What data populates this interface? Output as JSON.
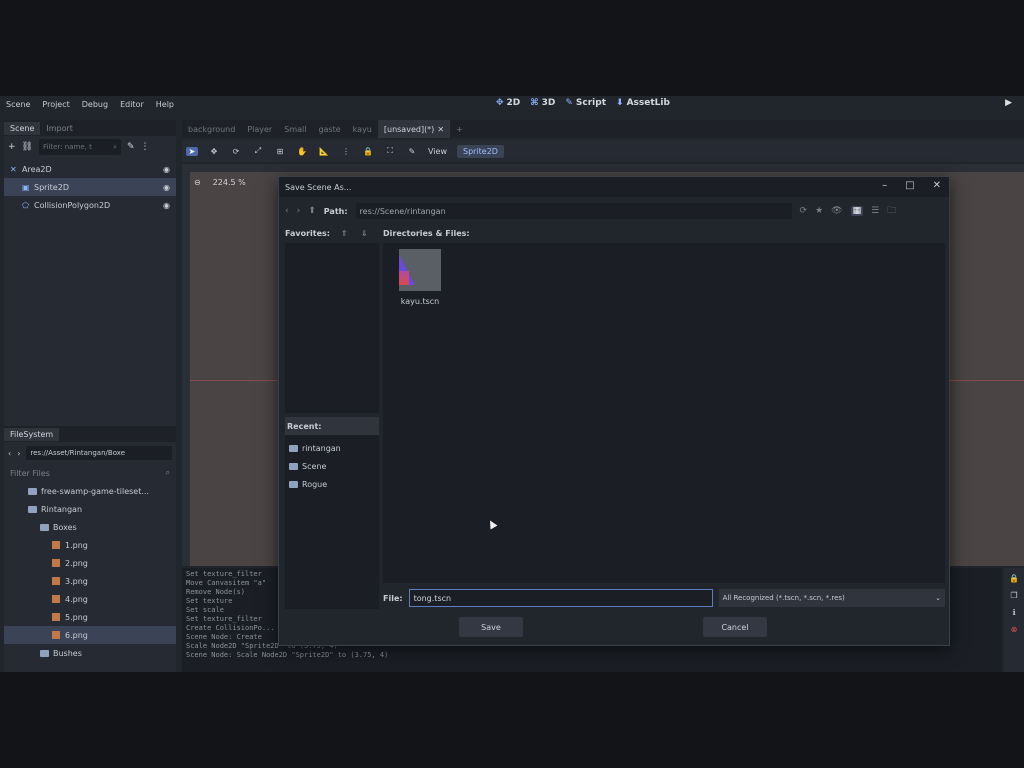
{
  "menu": [
    "Scene",
    "Project",
    "Debug",
    "Editor",
    "Help"
  ],
  "workspaces": [
    {
      "label": "2D",
      "icon": "2d-icon"
    },
    {
      "label": "3D",
      "icon": "3d-icon"
    },
    {
      "label": "Script",
      "icon": "script-icon"
    },
    {
      "label": "AssetLib",
      "icon": "assetlib-icon"
    }
  ],
  "left_dock": {
    "tabs": [
      "Scene",
      "Import"
    ],
    "filter_placeholder": "Filter: name, t",
    "nodes": [
      {
        "label": "Area2D",
        "icon": "area2d-icon",
        "selected": false
      },
      {
        "label": "Sprite2D",
        "icon": "sprite2d-icon",
        "selected": true
      },
      {
        "label": "CollisionPolygon2D",
        "icon": "collisionpolygon2d-icon",
        "selected": false
      }
    ]
  },
  "filesystem": {
    "tab": "FileSystem",
    "path": "res://Asset/Rintangan/Boxe",
    "filter_placeholder": "Filter Files",
    "items": [
      {
        "label": "free-swamp-game-tileset...",
        "type": "folder",
        "indent": 1
      },
      {
        "label": "Rintangan",
        "type": "folder",
        "indent": 1
      },
      {
        "label": "Boxes",
        "type": "folder",
        "indent": 2
      },
      {
        "label": "1.png",
        "type": "png",
        "indent": 3
      },
      {
        "label": "2.png",
        "type": "png",
        "indent": 3
      },
      {
        "label": "3.png",
        "type": "png",
        "indent": 3
      },
      {
        "label": "4.png",
        "type": "png",
        "indent": 3
      },
      {
        "label": "5.png",
        "type": "png",
        "indent": 3
      },
      {
        "label": "6.png",
        "type": "png",
        "indent": 3,
        "selected": true
      },
      {
        "label": "Bushes",
        "type": "folder",
        "indent": 2
      }
    ]
  },
  "scene_tabs": [
    "background",
    "Player",
    "Small",
    "gaste",
    "kayu",
    "[unsaved](*)"
  ],
  "toolbar2": {
    "view": "View",
    "chip": "Sprite2D"
  },
  "viewport": {
    "zoom": "224.5 %"
  },
  "output_lines": [
    "Set texture_filter",
    "Move Canvasitem \"a\"",
    "Remove Node(s)",
    "Set texture",
    "Set scale",
    "Set texture_filter",
    "Create CollisionPo...",
    "Scene Node: Create",
    "Scale Node2D \"Sprite2D\" to (3.75, 4)",
    "Scene Node: Scale Node2D \"Sprite2D\" to (3.75, 4)"
  ],
  "dialog": {
    "title": "Save Scene As...",
    "path_label": "Path:",
    "path": "res://Scene/rintangan",
    "favorites_label": "Favorites:",
    "dirs_label": "Directories & Files:",
    "recent_label": "Recent:",
    "recent": [
      "rintangan",
      "Scene",
      "Rogue"
    ],
    "files": [
      {
        "name": "kayu.tscn"
      }
    ],
    "file_label": "File:",
    "file_value": "tong.tscn",
    "filter": "All Recognized (*.tscn, *.scn, *.res)",
    "save_label": "Save",
    "cancel_label": "Cancel"
  }
}
